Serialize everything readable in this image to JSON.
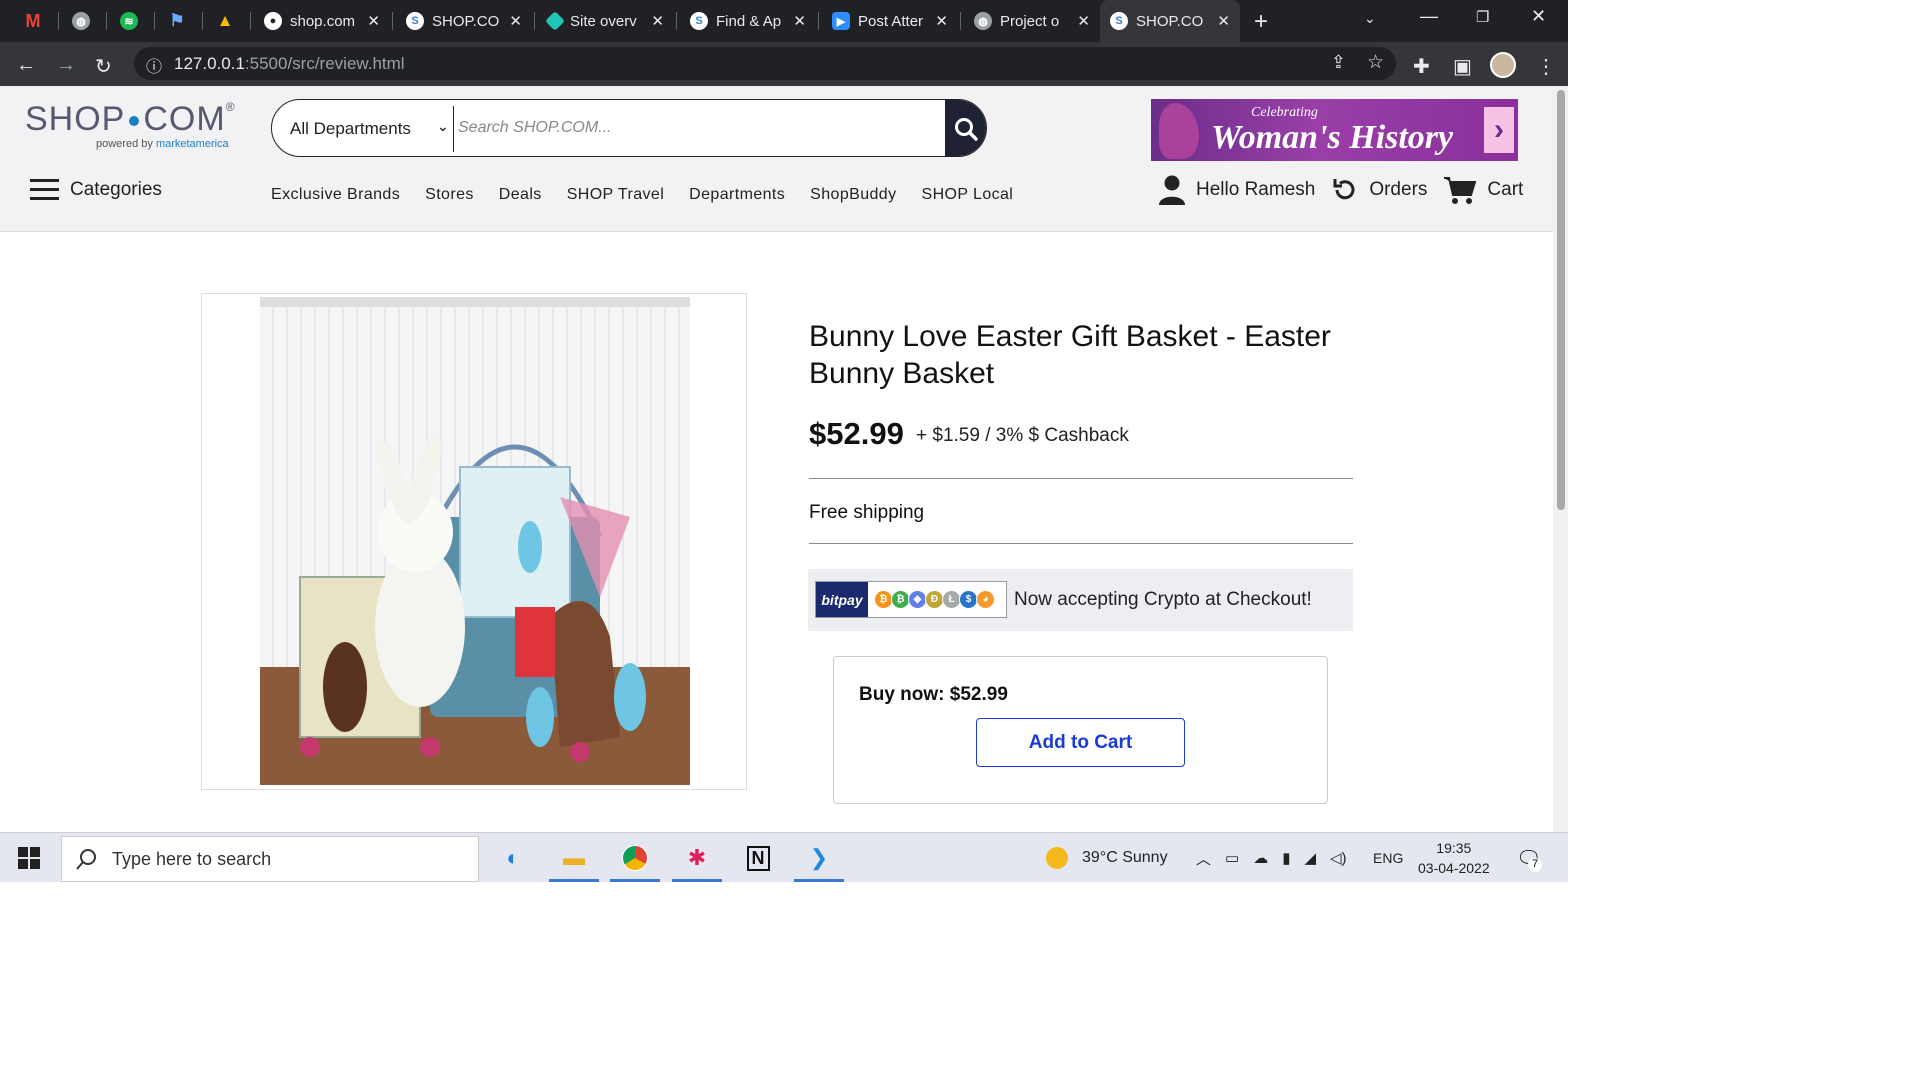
{
  "browser": {
    "tabs": [
      {
        "title": "",
        "icon": "gmail-icon"
      },
      {
        "title": "",
        "icon": "globe-icon"
      },
      {
        "title": "",
        "icon": "spotify-icon"
      },
      {
        "title": "",
        "icon": "flag-icon"
      },
      {
        "title": "",
        "icon": "drive-icon"
      },
      {
        "title": "shop.com",
        "icon": "github-icon"
      },
      {
        "title": "SHOP.CO",
        "icon": "shop-s-icon"
      },
      {
        "title": "Site overv",
        "icon": "netlify-icon"
      },
      {
        "title": "Find & Ap",
        "icon": "shop-s-icon"
      },
      {
        "title": "Post Atter",
        "icon": "zoom-icon"
      },
      {
        "title": "Project o",
        "icon": "globe-icon"
      },
      {
        "title": "SHOP.CO",
        "icon": "shop-s-icon",
        "active": true
      }
    ],
    "url_host": "127.0.0.1",
    "url_path": ":5500/src/review.html"
  },
  "header": {
    "logo_text": "SHOP",
    "logo_text2": "COM",
    "logo_reg": "®",
    "powered_by": "powered by ",
    "powered_brand": "marketamerica",
    "department_select": "All Departments",
    "search_placeholder": "Search SHOP.COM...",
    "banner_line1": "Celebrating",
    "banner_line2": "Woman's History",
    "categories_label": "Categories",
    "nav": [
      "Exclusive Brands",
      "Stores",
      "Deals",
      "SHOP Travel",
      "Departments",
      "ShopBuddy",
      "SHOP Local"
    ],
    "greeting": "Hello Ramesh",
    "orders_label": "Orders",
    "cart_label": "Cart"
  },
  "product": {
    "title": "Bunny Love Easter Gift Basket - Easter Bunny Basket",
    "price": "$52.99",
    "cashback": "+ $1.59 / 3% $ Cashback",
    "shipping": "Free shipping",
    "bitpay_label": "bitpay",
    "crypto_text": "Now accepting Crypto at Checkout!",
    "buy_now": "Buy now: $52.99",
    "add_to_cart": "Add to Cart"
  },
  "taskbar": {
    "search_placeholder": "Type here to search",
    "weather": "39°C  Sunny",
    "language": "ENG",
    "time": "19:35",
    "date": "03-04-2022",
    "notification_count": "7"
  }
}
